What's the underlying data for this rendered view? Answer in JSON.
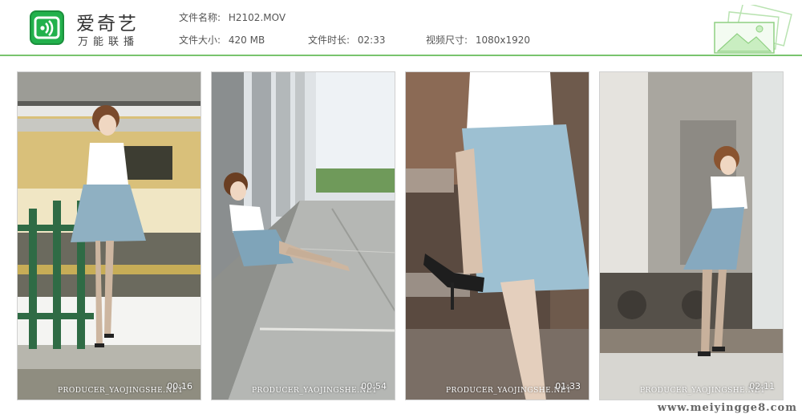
{
  "app": {
    "name": "爱奇艺",
    "subtitle": "万能联播"
  },
  "file_info": {
    "name_label": "文件名称:",
    "name_value": "H2102.MOV",
    "size_label": "文件大小:",
    "size_value": "420 MB",
    "duration_label": "文件时长:",
    "duration_value": "02:33",
    "dimension_label": "视频尺寸:",
    "dimension_value": "1080x1920"
  },
  "thumbnails": [
    {
      "producer": "PRODUCER_YAOJINGSHE.NET",
      "timestamp": "00:16"
    },
    {
      "producer": "PRODUCER_YAOJINGSHE.NET",
      "timestamp": "00:54"
    },
    {
      "producer": "PRODUCER_YAOJINGSHE.NET",
      "timestamp": "01:33"
    },
    {
      "producer": "PRODUCER_YAOJINGSHE.NET",
      "timestamp": "02:11"
    }
  ],
  "watermark": "www.meiyingge8.com",
  "colors": {
    "brand_green": "#22b14c",
    "header_line": "#79c46e"
  }
}
